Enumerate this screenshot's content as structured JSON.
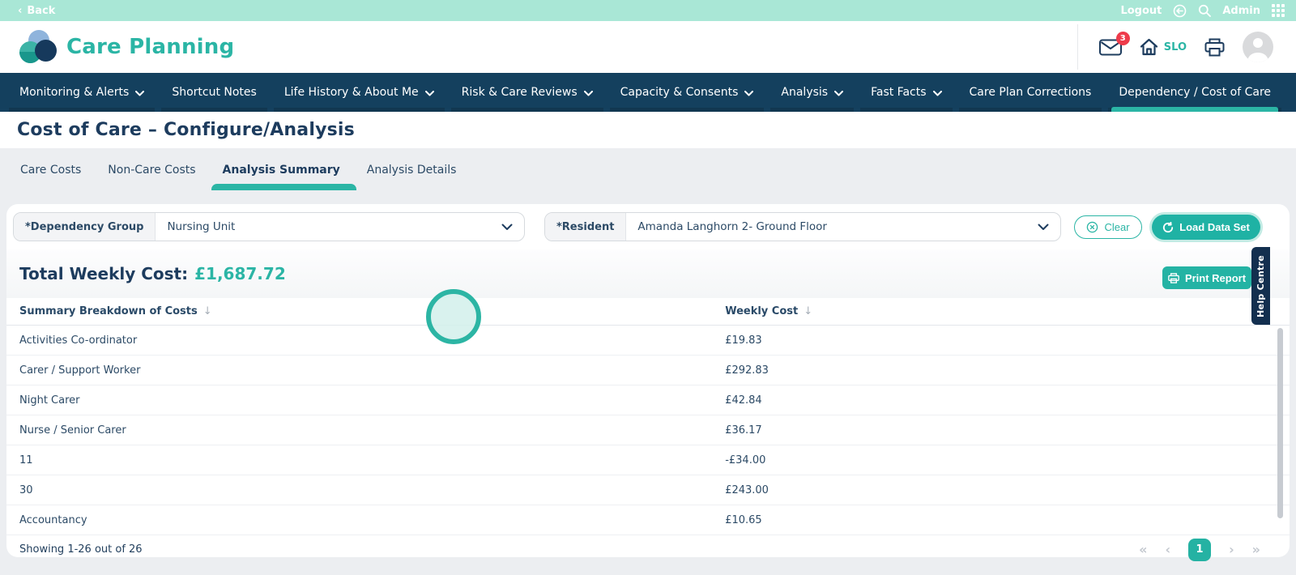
{
  "colors": {
    "accent_teal": "#2bb5a5",
    "navy": "#14405e",
    "mint": "#a9e7d6",
    "badge_red": "#ee3b4b"
  },
  "topbar": {
    "back_chevron": "‹",
    "back_label": "Back",
    "logout_label": "Logout",
    "admin_label": "Admin"
  },
  "header": {
    "app_title": "Care Planning",
    "mail_badge": "3",
    "site_code": "SLO"
  },
  "nav": {
    "items": [
      {
        "label": "Monitoring & Alerts",
        "dropdown": true,
        "active": false
      },
      {
        "label": "Shortcut Notes",
        "dropdown": false,
        "active": false
      },
      {
        "label": "Life History & About Me",
        "dropdown": true,
        "active": false
      },
      {
        "label": "Risk & Care Reviews",
        "dropdown": true,
        "active": false
      },
      {
        "label": "Capacity & Consents",
        "dropdown": true,
        "active": false
      },
      {
        "label": "Analysis",
        "dropdown": true,
        "active": false
      },
      {
        "label": "Fast Facts",
        "dropdown": true,
        "active": false
      },
      {
        "label": "Care Plan Corrections",
        "dropdown": false,
        "active": false
      },
      {
        "label": "Dependency / Cost of Care",
        "dropdown": false,
        "active": true
      }
    ]
  },
  "page": {
    "title": "Cost of Care – Configure/Analysis"
  },
  "tabs": {
    "items": [
      {
        "label": "Care Costs",
        "active": false
      },
      {
        "label": "Non-Care Costs",
        "active": false
      },
      {
        "label": "Analysis Summary",
        "active": true
      },
      {
        "label": "Analysis Details",
        "active": false
      }
    ]
  },
  "filters": {
    "dependency_group": {
      "label": "*Dependency Group",
      "value": "Nursing Unit"
    },
    "resident": {
      "label": "*Resident",
      "value": "Amanda Langhorn 2- Ground Floor"
    },
    "clear_label": "Clear",
    "load_label": "Load Data Set"
  },
  "summary": {
    "total_label": "Total Weekly Cost:",
    "total_value": "£1,687.72",
    "print_label": "Print Report"
  },
  "table": {
    "columns": [
      "Summary Breakdown of Costs",
      "Weekly Cost"
    ],
    "sort_icon": "↓",
    "rows": [
      {
        "name": "Activities Co-ordinator",
        "cost": "£19.83"
      },
      {
        "name": "Carer / Support Worker",
        "cost": "£292.83"
      },
      {
        "name": "Night Carer",
        "cost": "£42.84"
      },
      {
        "name": "Nurse / Senior Carer",
        "cost": "£36.17"
      },
      {
        "name": "11",
        "cost": "-£34.00"
      },
      {
        "name": "30",
        "cost": "£243.00"
      },
      {
        "name": "Accountancy",
        "cost": "£10.65"
      }
    ]
  },
  "pagination": {
    "status": "Showing 1-26 out of 26",
    "first": "«",
    "prev": "‹",
    "page": "1",
    "next": "›",
    "last": "»"
  },
  "help_tab": {
    "label": "Help Centre"
  }
}
